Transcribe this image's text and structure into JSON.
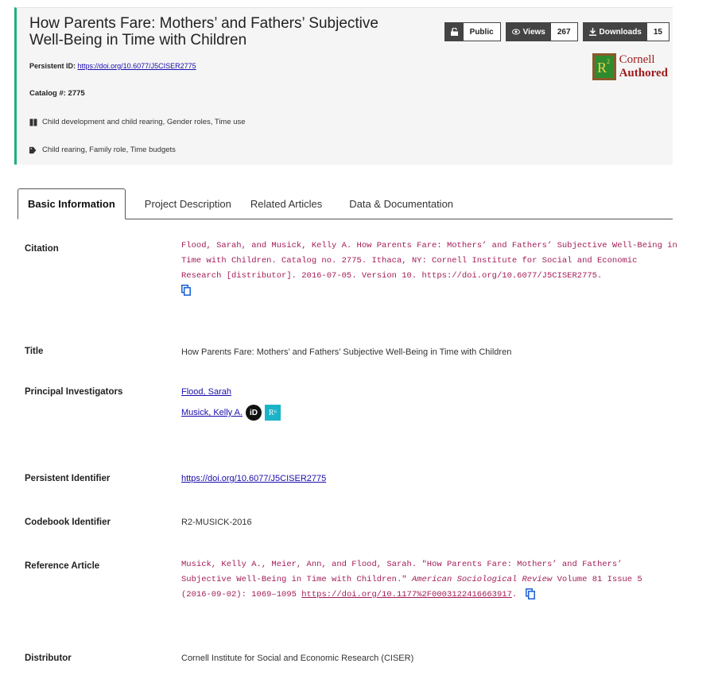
{
  "header": {
    "title": "How Parents Fare: Mothers’ and Fathers’ Subjective Well-Being in Time with Children",
    "pid_label": "Persistent ID:",
    "pid_link": "https://doi.org/10.6077/J5CISER2775",
    "catalog": "Catalog #: 2775",
    "subjects": "Child development and child rearing, Gender roles, Time use",
    "keywords": "Child rearing, Family role, Time budgets",
    "badges": {
      "public_label": "Public",
      "views_label": "Views",
      "views_count": "267",
      "downloads_label": "Downloads",
      "downloads_count": "15"
    },
    "cornell": {
      "line1": "Cornell",
      "line2": "Authored",
      "logo_text": "R2"
    }
  },
  "tabs": [
    {
      "label": "Basic Information",
      "active": true
    },
    {
      "label": "Project Description",
      "active": false
    },
    {
      "label": "Related Articles",
      "active": false
    },
    {
      "label": "Data & Documentation",
      "active": false
    }
  ],
  "fields": {
    "citation_label": "Citation",
    "citation_value": "Flood, Sarah, and Musick, Kelly A. How Parents Fare: Mothers’ and Fathers’ Subjective Well-Being in Time with Children. Catalog no. 2775. Ithaca, NY: Cornell Institute for Social and Economic Research [distributor]. 2016-07-05. Version 10. https://doi.org/10.6077/J5CISER2775.",
    "title_label": "Title",
    "title_value": "How Parents Fare: Mothers’ and Fathers’ Subjective Well-Being in Time with Children",
    "pi_label": "Principal Investigators",
    "pi_1": "Flood, Sarah",
    "pi_2": "Musick, Kelly A.",
    "orcid_text": "iD",
    "r6_text": "R⁶",
    "persistent_label": "Persistent Identifier",
    "persistent_value": "https://doi.org/10.6077/J5CISER2775",
    "codebook_label": "Codebook Identifier",
    "codebook_value": "R2-MUSICK-2016",
    "reference_label": "Reference Article",
    "reference_text_1": "Musick, Kelly A., Meier, Ann, and Flood, Sarah. \"How Parents Fare: Mothers’ and Fathers’ Subjective Well-Being in Time with Children.\" ",
    "reference_journal": "American Sociological Review",
    "reference_text_2": " Volume 81 Issue 5 (2016-09-02): 1069–1095 ",
    "reference_link": "https://doi.org/10.1177%2F0003122416663917",
    "reference_after": ".",
    "distributor_label": "Distributor",
    "distributor_value": "Cornell Institute for Social and Economic Research (CISER)"
  },
  "colors": {
    "accent": "#1fb07a",
    "mono_text": "#a31d58",
    "badge_bg": "#444444",
    "cornell_red": "#9e1b1b"
  }
}
